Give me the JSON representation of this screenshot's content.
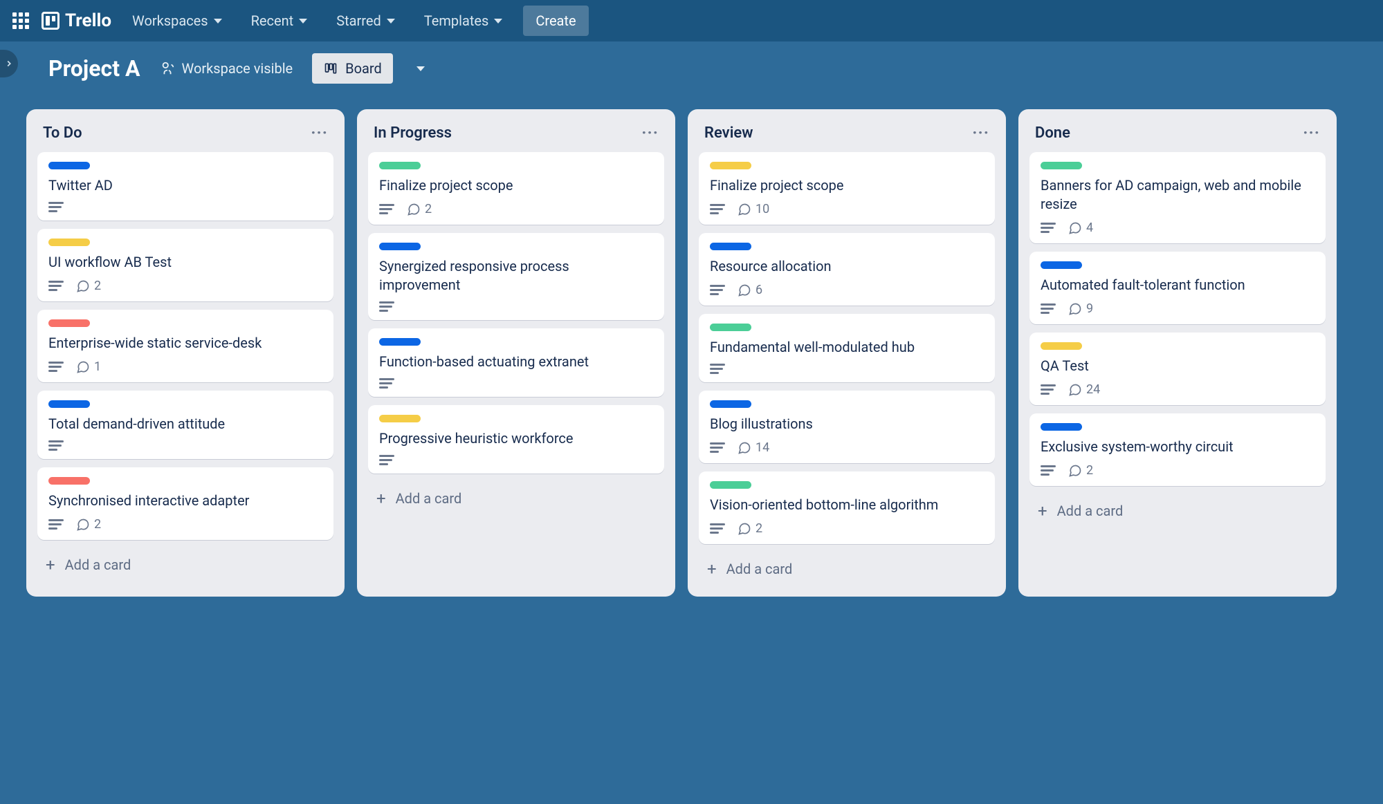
{
  "nav": {
    "brand": "Trello",
    "items": [
      {
        "label": "Workspaces"
      },
      {
        "label": "Recent"
      },
      {
        "label": "Starred"
      },
      {
        "label": "Templates"
      }
    ],
    "create": "Create"
  },
  "boardHeader": {
    "title": "Project A",
    "visibility": "Workspace visible",
    "viewLabel": "Board"
  },
  "labelColors": {
    "blue": "#0c66e4",
    "yellow": "#f5cd47",
    "red": "#f87168",
    "green": "#4bce97"
  },
  "lists": [
    {
      "name": "To Do",
      "cards": [
        {
          "label": "blue",
          "title": "Twitter AD",
          "hasDesc": true,
          "comments": null
        },
        {
          "label": "yellow",
          "title": "UI workflow AB Test",
          "hasDesc": true,
          "comments": 2
        },
        {
          "label": "red",
          "title": "Enterprise-wide static service-desk",
          "hasDesc": true,
          "comments": 1
        },
        {
          "label": "blue",
          "title": "Total demand-driven attitude",
          "hasDesc": true,
          "comments": null
        },
        {
          "label": "red",
          "title": "Synchronised interactive adapter",
          "hasDesc": true,
          "comments": 2
        }
      ]
    },
    {
      "name": "In Progress",
      "cards": [
        {
          "label": "green",
          "title": "Finalize project scope",
          "hasDesc": true,
          "comments": 2
        },
        {
          "label": "blue",
          "title": "Synergized responsive process improvement",
          "hasDesc": true,
          "comments": null
        },
        {
          "label": "blue",
          "title": "Function-based actuating extranet",
          "hasDesc": true,
          "comments": null
        },
        {
          "label": "yellow",
          "title": "Progressive heuristic workforce",
          "hasDesc": true,
          "comments": null
        }
      ]
    },
    {
      "name": "Review",
      "cards": [
        {
          "label": "yellow",
          "title": "Finalize project scope",
          "hasDesc": true,
          "comments": 10
        },
        {
          "label": "blue",
          "title": "Resource allocation",
          "hasDesc": true,
          "comments": 6
        },
        {
          "label": "green",
          "title": "Fundamental well-modulated hub",
          "hasDesc": true,
          "comments": null
        },
        {
          "label": "blue",
          "title": "Blog illustrations",
          "hasDesc": true,
          "comments": 14
        },
        {
          "label": "green",
          "title": "Vision-oriented bottom-line algorithm",
          "hasDesc": true,
          "comments": 2
        }
      ]
    },
    {
      "name": "Done",
      "cards": [
        {
          "label": "green",
          "title": "Banners for AD campaign, web and mobile resize",
          "hasDesc": true,
          "comments": 4
        },
        {
          "label": "blue",
          "title": "Automated fault-tolerant function",
          "hasDesc": true,
          "comments": 9
        },
        {
          "label": "yellow",
          "title": "QA Test",
          "hasDesc": true,
          "comments": 24
        },
        {
          "label": "blue",
          "title": "Exclusive system-worthy circuit",
          "hasDesc": true,
          "comments": 2
        }
      ]
    }
  ],
  "addCardLabel": "Add a card"
}
